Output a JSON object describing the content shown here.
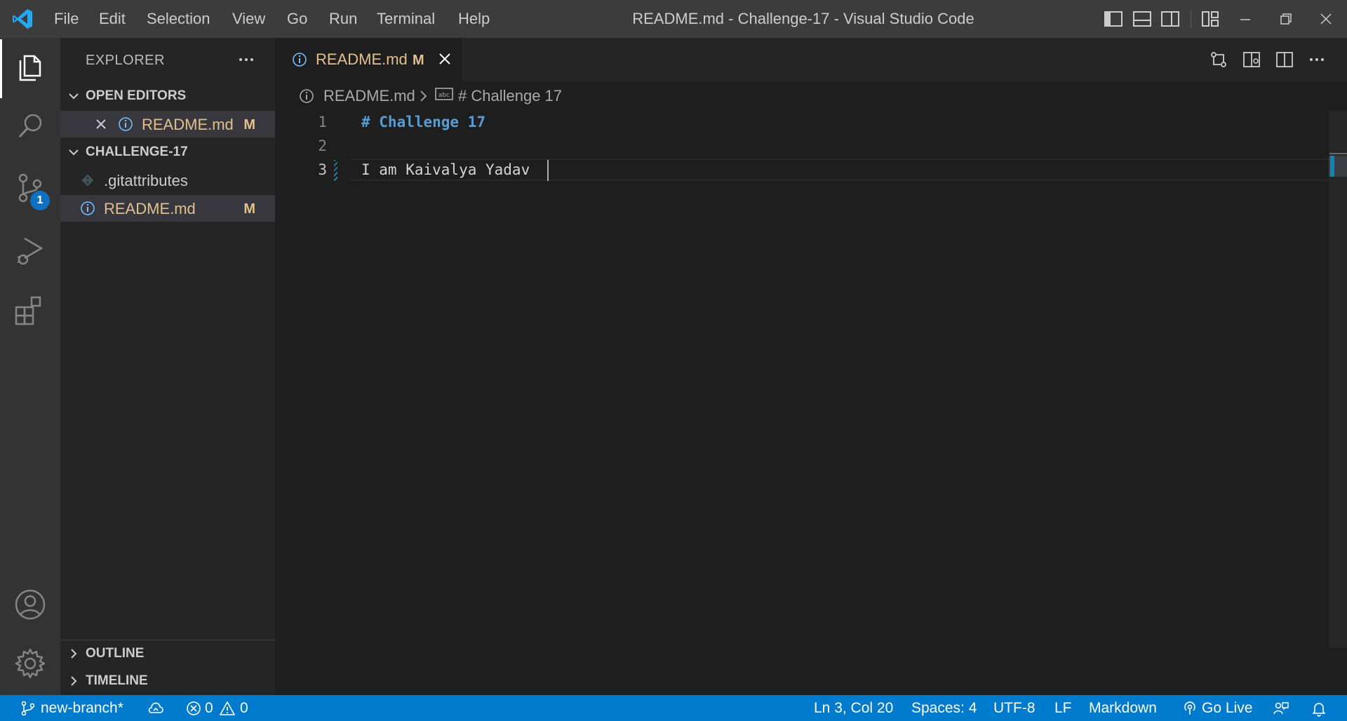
{
  "titlebar": {
    "menu": [
      "File",
      "Edit",
      "Selection",
      "View",
      "Go",
      "Run",
      "Terminal",
      "Help"
    ],
    "window_title": "README.md - Challenge-17 - Visual Studio Code",
    "icons": [
      "toggle-primary-sidebar-icon",
      "toggle-panel-icon",
      "toggle-secondary-sidebar-icon",
      "customize-layout-icon",
      "minimize-icon",
      "restore-icon",
      "close-icon"
    ]
  },
  "activitybar": {
    "items": [
      "explorer-icon",
      "search-icon",
      "source-control-icon",
      "run-debug-icon",
      "extensions-icon"
    ],
    "scm_badge": "1",
    "bottom": [
      "accounts-icon",
      "manage-gear-icon"
    ]
  },
  "sidebar": {
    "title": "EXPLORER",
    "open_editors": {
      "header": "OPEN EDITORS",
      "items": [
        {
          "name": "README.md",
          "status": "M"
        }
      ]
    },
    "folder": {
      "header": "CHALLENGE-17",
      "items": [
        {
          "name": ".gitattributes",
          "status": ""
        },
        {
          "name": "README.md",
          "status": "M"
        }
      ]
    },
    "outline": "OUTLINE",
    "timeline": "TIMELINE"
  },
  "editor": {
    "tab": {
      "label": "README.md",
      "status": "M"
    },
    "breadcrumb": {
      "file": "README.md",
      "symbol": "# Challenge 17"
    },
    "lines": [
      {
        "num": "1",
        "text": "# Challenge 17"
      },
      {
        "num": "2",
        "text": ""
      },
      {
        "num": "3",
        "text": "I am Kaivalya Yadav"
      }
    ]
  },
  "statusbar": {
    "branch": "new-branch*",
    "errors": "0",
    "warnings": "0",
    "position": "Ln 3, Col 20",
    "indent": "Spaces: 4",
    "encoding": "UTF-8",
    "eol": "LF",
    "language": "Markdown",
    "go_live": "Go Live"
  },
  "colors": {
    "accent": "#007acc",
    "modified": "#e2c08d",
    "heading": "#569cd6",
    "info_icon": "#75beff"
  }
}
